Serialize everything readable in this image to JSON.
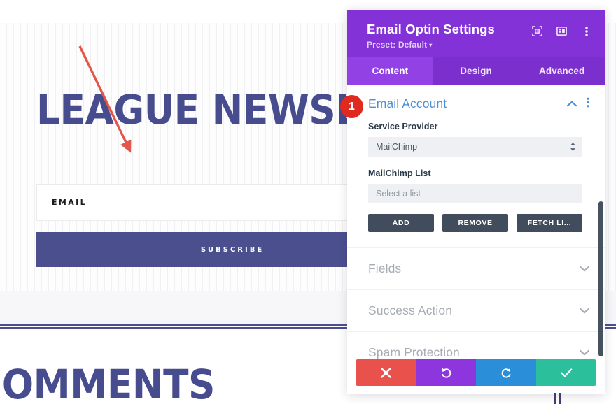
{
  "page_preview": {
    "newsletter_title": "LEAGUE NEWSLETTER",
    "email_field_placeholder": "EMAIL",
    "subscribe_label": "SUBSCRIBE",
    "below_heading": "COMMENTS",
    "accent_color": "#4b4f8e"
  },
  "annotation": {
    "badge_number": "1",
    "badge_color": "#e02a20",
    "arrow_color": "#e2574c"
  },
  "panel": {
    "title": "Email Optin Settings",
    "preset_label": "Preset: Default",
    "preset_caret": "▾",
    "header_icons": [
      {
        "name": "focus-icon"
      },
      {
        "name": "panel-layout-icon"
      },
      {
        "name": "more-vertical-icon"
      }
    ],
    "tabs": [
      {
        "label": "Content",
        "active": true
      },
      {
        "label": "Design",
        "active": false
      },
      {
        "label": "Advanced",
        "active": false
      }
    ],
    "open_section": {
      "title": "Email Account",
      "collapse_icon": "chevron-up-icon",
      "menu_icon": "more-vertical-icon",
      "fields": {
        "service_provider": {
          "label": "Service Provider",
          "value": "MailChimp"
        },
        "mailchimp_list": {
          "label": "MailChimp List",
          "placeholder": "Select a list",
          "value": ""
        }
      },
      "buttons": [
        {
          "label": "ADD"
        },
        {
          "label": "REMOVE"
        },
        {
          "label": "FETCH LI..."
        }
      ]
    },
    "collapsed_sections": [
      {
        "label": "Fields"
      },
      {
        "label": "Success Action"
      },
      {
        "label": "Spam Protection"
      }
    ],
    "footer_buttons": [
      {
        "name": "cancel",
        "icon": "close-icon",
        "color": "#e8514c"
      },
      {
        "name": "undo",
        "icon": "undo-icon",
        "color": "#8d36dd"
      },
      {
        "name": "redo",
        "icon": "redo-icon",
        "color": "#2a8fd8"
      },
      {
        "name": "save",
        "icon": "check-icon",
        "color": "#2bbf9b"
      }
    ],
    "colors": {
      "header_purple": "#8332d8",
      "tab_bar_purple": "#7b2fcd",
      "active_tab_purple": "#9241e5",
      "section_title_blue": "#4c8fd4",
      "dark_button": "#414d5c"
    }
  }
}
